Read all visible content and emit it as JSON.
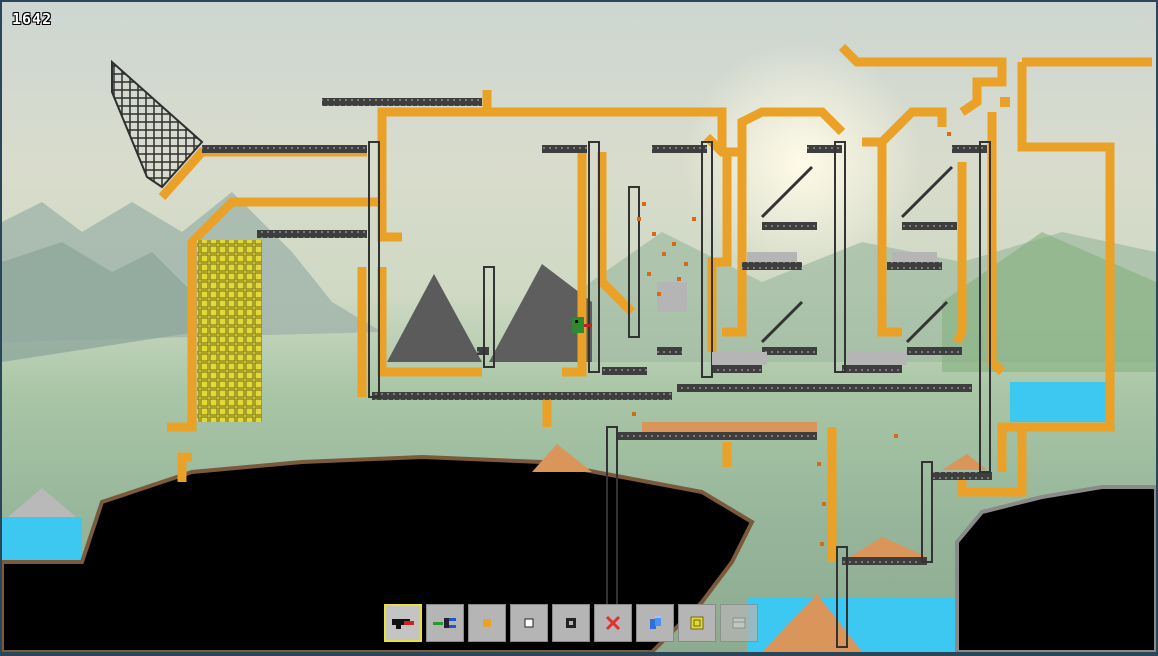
{
  "hud": {
    "counter": "1642"
  },
  "colors": {
    "pipe": "#e9a227",
    "pipe_dark": "#b97a12",
    "rail": "#4a4a4a",
    "water": "#3cc8f0",
    "sand": "#d9955a",
    "ground": "#000000",
    "yellow_block": "#e2d83a",
    "selected_outline": "#e8e040"
  },
  "toolbar": {
    "selected": "gun-tool",
    "tools": [
      {
        "name": "gun-tool",
        "icon": "red-gun-icon"
      },
      {
        "name": "pipe-connector-tool",
        "icon": "connector-icon"
      },
      {
        "name": "orange-block-tool",
        "icon": "orange-block-icon"
      },
      {
        "name": "empty-block-tool",
        "icon": "white-square-icon"
      },
      {
        "name": "ring-block-tool",
        "icon": "black-ring-icon"
      },
      {
        "name": "delete-tool",
        "icon": "red-x-icon"
      },
      {
        "name": "cylinder-tool",
        "icon": "blue-cylinder-icon"
      },
      {
        "name": "crate-tool",
        "icon": "yellow-crate-icon"
      },
      {
        "name": "disabled-tool",
        "icon": "grey-panel-icon"
      }
    ]
  }
}
